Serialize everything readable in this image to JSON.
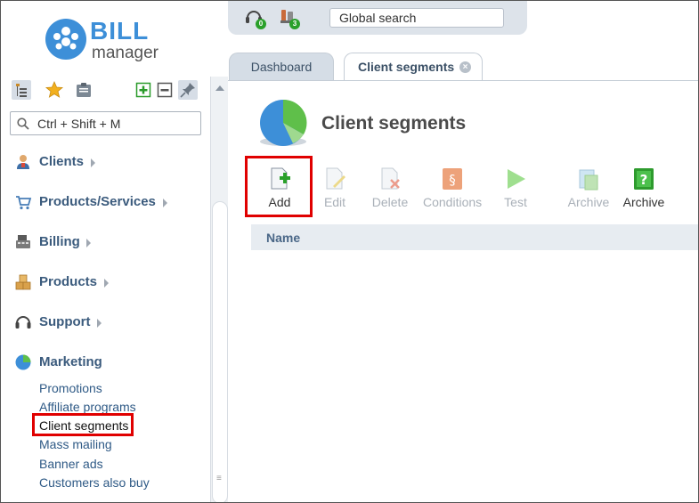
{
  "topbar": {
    "support_badge": "0",
    "tasks_badge": "3",
    "search_placeholder": "Global search"
  },
  "logo": {
    "bill": "BILL",
    "manager": "manager"
  },
  "sidebar": {
    "search_placeholder": "Ctrl + Shift + M",
    "items": [
      {
        "label": "Clients",
        "icon": "clients-icon"
      },
      {
        "label": "Products/Services",
        "icon": "cart-icon"
      },
      {
        "label": "Billing",
        "icon": "cash-register-icon"
      },
      {
        "label": "Products",
        "icon": "boxes-icon"
      },
      {
        "label": "Support",
        "icon": "headset-icon"
      },
      {
        "label": "Marketing",
        "icon": "pie-chart-icon"
      }
    ],
    "marketing_sub": [
      "Promotions",
      "Affiliate programs",
      "Client segments",
      "Mass mailing",
      "Banner ads",
      "Customers also buy"
    ]
  },
  "tabs": [
    {
      "label": "Dashboard"
    },
    {
      "label": "Client segments"
    }
  ],
  "main": {
    "title": "Client segments",
    "toolbar": [
      {
        "label": "Add",
        "enabled": true
      },
      {
        "label": "Edit",
        "enabled": false
      },
      {
        "label": "Delete",
        "enabled": false
      },
      {
        "label": "Conditions",
        "enabled": false
      },
      {
        "label": "Test",
        "enabled": false
      },
      {
        "label": "Archive",
        "enabled": false
      },
      {
        "label": "Archive",
        "enabled": true
      }
    ],
    "grid_columns": [
      "Name"
    ]
  },
  "colors": {
    "accent": "#3d8fd8",
    "highlight_box": "#e00000",
    "nav_text": "#3b5b7d",
    "link_text": "#2f5a86"
  }
}
